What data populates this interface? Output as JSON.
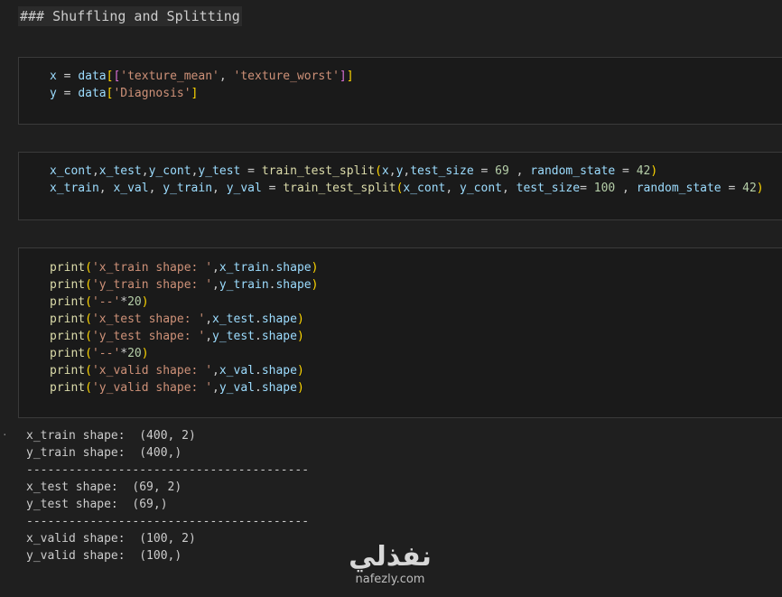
{
  "markdown_cell": {
    "text": "### Shuffling and Splitting"
  },
  "cells": [
    {
      "lines": [
        [
          {
            "t": "x",
            "c": "ident"
          },
          {
            "t": " = ",
            "c": "plain"
          },
          {
            "t": "data",
            "c": "ident"
          },
          {
            "t": "[",
            "c": "br1"
          },
          {
            "t": "[",
            "c": "br2"
          },
          {
            "t": "'texture_mean'",
            "c": "str"
          },
          {
            "t": ", ",
            "c": "plain"
          },
          {
            "t": "'texture_worst'",
            "c": "str"
          },
          {
            "t": "]",
            "c": "br2"
          },
          {
            "t": "]",
            "c": "br1"
          }
        ],
        [
          {
            "t": "y",
            "c": "ident"
          },
          {
            "t": " = ",
            "c": "plain"
          },
          {
            "t": "data",
            "c": "ident"
          },
          {
            "t": "[",
            "c": "br1"
          },
          {
            "t": "'Diagnosis'",
            "c": "str"
          },
          {
            "t": "]",
            "c": "br1"
          }
        ]
      ]
    },
    {
      "lines": [
        [
          {
            "t": "x_cont",
            "c": "ident"
          },
          {
            "t": ",",
            "c": "plain"
          },
          {
            "t": "x_test",
            "c": "ident"
          },
          {
            "t": ",",
            "c": "plain"
          },
          {
            "t": "y_cont",
            "c": "ident"
          },
          {
            "t": ",",
            "c": "plain"
          },
          {
            "t": "y_test",
            "c": "ident"
          },
          {
            "t": " = ",
            "c": "plain"
          },
          {
            "t": "train_test_split",
            "c": "fn"
          },
          {
            "t": "(",
            "c": "br1"
          },
          {
            "t": "x",
            "c": "ident"
          },
          {
            "t": ",",
            "c": "plain"
          },
          {
            "t": "y",
            "c": "ident"
          },
          {
            "t": ",",
            "c": "plain"
          },
          {
            "t": "test_size",
            "c": "ident"
          },
          {
            "t": " = ",
            "c": "plain"
          },
          {
            "t": "69",
            "c": "num"
          },
          {
            "t": " , ",
            "c": "plain"
          },
          {
            "t": "random_state",
            "c": "ident"
          },
          {
            "t": " = ",
            "c": "plain"
          },
          {
            "t": "42",
            "c": "num"
          },
          {
            "t": ")",
            "c": "br1"
          }
        ],
        [
          {
            "t": "x_train",
            "c": "ident"
          },
          {
            "t": ", ",
            "c": "plain"
          },
          {
            "t": "x_val",
            "c": "ident"
          },
          {
            "t": ", ",
            "c": "plain"
          },
          {
            "t": "y_train",
            "c": "ident"
          },
          {
            "t": ", ",
            "c": "plain"
          },
          {
            "t": "y_val",
            "c": "ident"
          },
          {
            "t": " = ",
            "c": "plain"
          },
          {
            "t": "train_test_split",
            "c": "fn"
          },
          {
            "t": "(",
            "c": "br1"
          },
          {
            "t": "x_cont",
            "c": "ident"
          },
          {
            "t": ", ",
            "c": "plain"
          },
          {
            "t": "y_cont",
            "c": "ident"
          },
          {
            "t": ", ",
            "c": "plain"
          },
          {
            "t": "test_size",
            "c": "ident"
          },
          {
            "t": "= ",
            "c": "plain"
          },
          {
            "t": "100",
            "c": "num"
          },
          {
            "t": " , ",
            "c": "plain"
          },
          {
            "t": "random_state",
            "c": "ident"
          },
          {
            "t": " = ",
            "c": "plain"
          },
          {
            "t": "42",
            "c": "num"
          },
          {
            "t": ")",
            "c": "br1"
          }
        ]
      ]
    },
    {
      "lines": [
        [
          {
            "t": "print",
            "c": "fn"
          },
          {
            "t": "(",
            "c": "br1"
          },
          {
            "t": "'x_train shape: '",
            "c": "str"
          },
          {
            "t": ",",
            "c": "plain"
          },
          {
            "t": "x_train",
            "c": "ident"
          },
          {
            "t": ".",
            "c": "plain"
          },
          {
            "t": "shape",
            "c": "ident"
          },
          {
            "t": ")",
            "c": "br1"
          }
        ],
        [
          {
            "t": "print",
            "c": "fn"
          },
          {
            "t": "(",
            "c": "br1"
          },
          {
            "t": "'y_train shape: '",
            "c": "str"
          },
          {
            "t": ",",
            "c": "plain"
          },
          {
            "t": "y_train",
            "c": "ident"
          },
          {
            "t": ".",
            "c": "plain"
          },
          {
            "t": "shape",
            "c": "ident"
          },
          {
            "t": ")",
            "c": "br1"
          }
        ],
        [
          {
            "t": "print",
            "c": "fn"
          },
          {
            "t": "(",
            "c": "br1"
          },
          {
            "t": "'--'",
            "c": "str"
          },
          {
            "t": "*",
            "c": "plain"
          },
          {
            "t": "20",
            "c": "num"
          },
          {
            "t": ")",
            "c": "br1"
          }
        ],
        [
          {
            "t": "print",
            "c": "fn"
          },
          {
            "t": "(",
            "c": "br1"
          },
          {
            "t": "'x_test shape: '",
            "c": "str"
          },
          {
            "t": ",",
            "c": "plain"
          },
          {
            "t": "x_test",
            "c": "ident"
          },
          {
            "t": ".",
            "c": "plain"
          },
          {
            "t": "shape",
            "c": "ident"
          },
          {
            "t": ")",
            "c": "br1"
          }
        ],
        [
          {
            "t": "print",
            "c": "fn"
          },
          {
            "t": "(",
            "c": "br1"
          },
          {
            "t": "'y_test shape: '",
            "c": "str"
          },
          {
            "t": ",",
            "c": "plain"
          },
          {
            "t": "y_test",
            "c": "ident"
          },
          {
            "t": ".",
            "c": "plain"
          },
          {
            "t": "shape",
            "c": "ident"
          },
          {
            "t": ")",
            "c": "br1"
          }
        ],
        [
          {
            "t": "print",
            "c": "fn"
          },
          {
            "t": "(",
            "c": "br1"
          },
          {
            "t": "'--'",
            "c": "str"
          },
          {
            "t": "*",
            "c": "plain"
          },
          {
            "t": "20",
            "c": "num"
          },
          {
            "t": ")",
            "c": "br1"
          }
        ],
        [
          {
            "t": "print",
            "c": "fn"
          },
          {
            "t": "(",
            "c": "br1"
          },
          {
            "t": "'x_valid shape: '",
            "c": "str"
          },
          {
            "t": ",",
            "c": "plain"
          },
          {
            "t": "x_val",
            "c": "ident"
          },
          {
            "t": ".",
            "c": "plain"
          },
          {
            "t": "shape",
            "c": "ident"
          },
          {
            "t": ")",
            "c": "br1"
          }
        ],
        [
          {
            "t": "print",
            "c": "fn"
          },
          {
            "t": "(",
            "c": "br1"
          },
          {
            "t": "'y_valid shape: '",
            "c": "str"
          },
          {
            "t": ",",
            "c": "plain"
          },
          {
            "t": "y_val",
            "c": "ident"
          },
          {
            "t": ".",
            "c": "plain"
          },
          {
            "t": "shape",
            "c": "ident"
          },
          {
            "t": ")",
            "c": "br1"
          }
        ]
      ]
    }
  ],
  "output": {
    "marker": "·",
    "lines": [
      "x_train shape:  (400, 2)",
      "y_train shape:  (400,)",
      "----------------------------------------",
      "x_test shape:  (69, 2)",
      "y_test shape:  (69,)",
      "----------------------------------------",
      "x_valid shape:  (100, 2)",
      "y_valid shape:  (100,)"
    ]
  },
  "watermark": {
    "arabic": "نفذلي",
    "latin": "nafezly.com"
  },
  "colors": {
    "background": "#1f1f1f",
    "cell_background": "#1a1a1a",
    "cell_border": "#3a3a3a",
    "identifier": "#9cdcfe",
    "function": "#dcdcaa",
    "string": "#ce9178",
    "number": "#b5cea8",
    "bracket_level1": "#ffd700",
    "bracket_level2": "#da70d6"
  }
}
